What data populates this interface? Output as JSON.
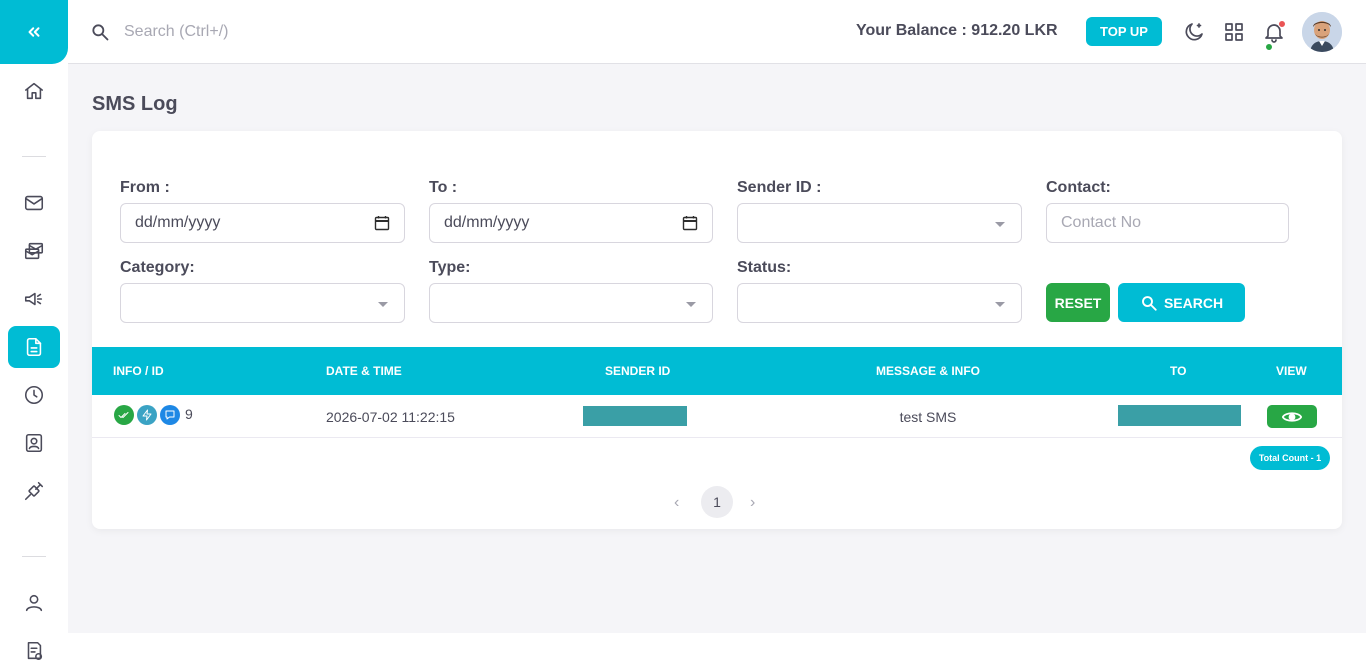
{
  "header": {
    "search_placeholder": "Search (Ctrl+/)",
    "balance": "Your Balance : 912.20 LKR",
    "topup_label": "TOP UP"
  },
  "sidebar": {
    "items": [
      {
        "name": "home-icon"
      },
      {
        "name": "mail-icon"
      },
      {
        "name": "bulk-mail-icon"
      },
      {
        "name": "megaphone-icon"
      },
      {
        "name": "document-icon",
        "active": true
      },
      {
        "name": "clock-icon"
      },
      {
        "name": "contact-card-icon"
      },
      {
        "name": "plug-icon"
      },
      {
        "name": "user-icon"
      },
      {
        "name": "report-icon"
      }
    ]
  },
  "page": {
    "title": "SMS Log"
  },
  "filters": {
    "from_label": "From :",
    "from_value": "dd/mm/yyyy",
    "to_label": "To :",
    "to_value": "dd/mm/yyyy",
    "sender_label": "Sender ID :",
    "contact_label": "Contact:",
    "contact_placeholder": "Contact No",
    "category_label": "Category:",
    "type_label": "Type:",
    "status_label": "Status:",
    "reset_label": "RESET",
    "search_label": "SEARCH"
  },
  "table": {
    "columns": [
      "INFO / ID",
      "DATE & TIME",
      "SENDER ID",
      "MESSAGE & INFO",
      "TO",
      "VIEW"
    ],
    "rows": [
      {
        "id": "9",
        "datetime": "2026-07-02 11:22:15",
        "message": "test SMS",
        "status_icons": [
          "delivered-check-icon",
          "flash-icon",
          "message-icon"
        ]
      }
    ],
    "total_count": "Total Count - 1"
  },
  "pagination": {
    "current_page": "1"
  },
  "colors": {
    "primary": "#00bcd4",
    "success": "#28a745",
    "notification": "#ea5455"
  }
}
